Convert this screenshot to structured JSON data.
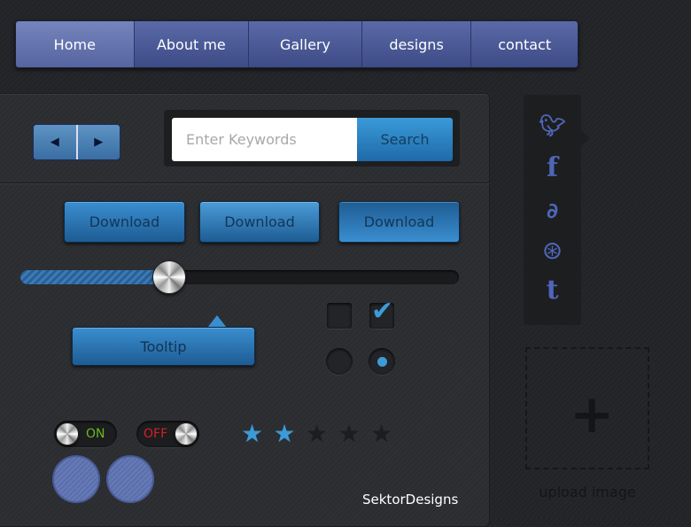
{
  "nav": {
    "items": [
      {
        "label": "Home",
        "active": true
      },
      {
        "label": "About me"
      },
      {
        "label": "Gallery"
      },
      {
        "label": "designs"
      },
      {
        "label": "contact"
      }
    ]
  },
  "pager": {
    "prev_icon": "triangle-left-icon",
    "next_icon": "triangle-right-icon"
  },
  "search": {
    "placeholder": "Enter Keywords",
    "button_label": "Search"
  },
  "downloads": [
    "Download",
    "Download",
    "Download"
  ],
  "slider": {
    "value_percent": 34
  },
  "tooltip": {
    "label": "Tooltip"
  },
  "checkboxes": [
    {
      "checked": false
    },
    {
      "checked": true
    }
  ],
  "radios": [
    {
      "selected": false
    },
    {
      "selected": true
    }
  ],
  "toggles": {
    "on_label": "ON",
    "off_label": "OFF",
    "on_color": "#6ab820",
    "off_color": "#d42020"
  },
  "rating": {
    "value": 2,
    "max": 5,
    "active_color": "#3d9bd8"
  },
  "brand": "SektorDesigns",
  "social": [
    "twitter-icon",
    "facebook-icon",
    "deviantart-icon",
    "dribbble-icon",
    "tumblr-icon"
  ],
  "upload": {
    "label": "upload image"
  }
}
